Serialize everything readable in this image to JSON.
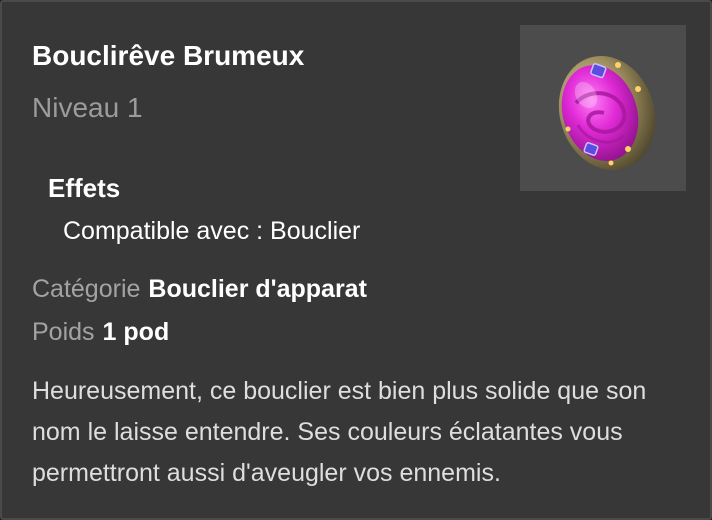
{
  "item": {
    "name": "Bouclirêve Brumeux",
    "level": "Niveau 1",
    "image_icon": "shield-icon"
  },
  "effects": {
    "title": "Effets",
    "lines": [
      "Compatible avec : Bouclier"
    ]
  },
  "properties": {
    "category_label": "Catégorie",
    "category_value": "Bouclier d'apparat",
    "weight_label": "Poids",
    "weight_value": "1 pod"
  },
  "description": "Heureusement, ce bouclier est bien plus solide que son nom le laisse entendre. Ses couleurs éclatantes vous permettront aussi d'aveugler vos ennemis.",
  "colors": {
    "card_background": "#373737",
    "muted_text": "#9c9c9c",
    "shield_gem": "#d82bd0",
    "shield_rim": "#a89a6a"
  }
}
